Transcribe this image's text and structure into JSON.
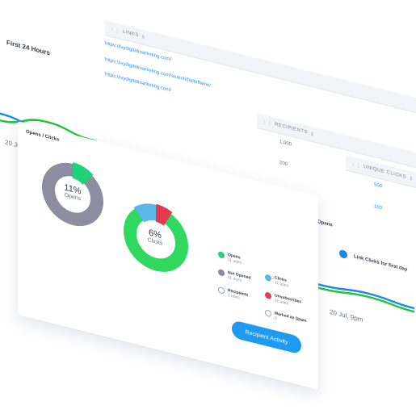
{
  "links_table": {
    "header_links": "LINKS",
    "header_recipients": "RECIPIENTS",
    "header_unique_clicks": "UNIQUE CLICKS",
    "rows": [
      {
        "url": "https://ivydigitalmarketing.com/",
        "recipients": "1,000",
        "unique_clicks": "500"
      },
      {
        "url": "https://ivydigitalmarketing.com/search/halloffame/",
        "recipients": "200",
        "unique_clicks": "150"
      },
      {
        "url": "https://ivydigitalmarketing.com/",
        "recipients": "",
        "unique_clicks": ""
      }
    ]
  },
  "chart": {
    "title": "First 24 Hours",
    "x_start": "20 Jul",
    "x_end": "20 Jul, 9pm",
    "legend": [
      {
        "name": "Opens",
        "color": "#22c33c"
      },
      {
        "name": "Link Clicks for first day",
        "color": "#1e88e5"
      }
    ]
  },
  "chart_data": {
    "type": "line",
    "title": "First 24 Hours",
    "xlabel": "",
    "ylabel": "",
    "x": [
      "20 Jul",
      "",
      "",
      "",
      "",
      "",
      "",
      "",
      "",
      "20 Jul, 9pm"
    ],
    "series": [
      {
        "name": "Opens",
        "values": [
          68,
          74,
          70,
          48,
          30,
          36,
          22,
          16,
          18,
          16
        ]
      },
      {
        "name": "Link Clicks for first day",
        "values": [
          72,
          68,
          58,
          40,
          38,
          36,
          24,
          18,
          20,
          18
        ]
      }
    ],
    "grid": false,
    "legend_position": "right"
  },
  "donut_panel": {
    "title": "Opens / Clicks",
    "opens_pct": "11%",
    "opens_label": "Opens",
    "clicks_pct": "6%",
    "clicks_label": "Clicks",
    "legend": [
      {
        "name": "Opens",
        "count": "11 uses",
        "color": "#25d08a"
      },
      {
        "name": "Not Opened",
        "count": "11 uses",
        "color": "#8a8aa0"
      },
      {
        "name": "Recipients",
        "count": "1 uses",
        "color": "#ffffff"
      },
      {
        "name": "Clicks",
        "count": "11 uses",
        "color": "#5bb6ea"
      },
      {
        "name": "Unsubscribes",
        "count": "11 uses",
        "color": "#e23a4e"
      },
      {
        "name": "Marked as Spam",
        "count": "0",
        "color": "#ffffff"
      }
    ],
    "button_label": "Recipient Activity",
    "colors": {
      "opens_green": "#1fd17a",
      "opens_gray": "#8d8da2",
      "clicks_green": "#2fd85e",
      "clicks_teal": "#22c0b0"
    }
  }
}
